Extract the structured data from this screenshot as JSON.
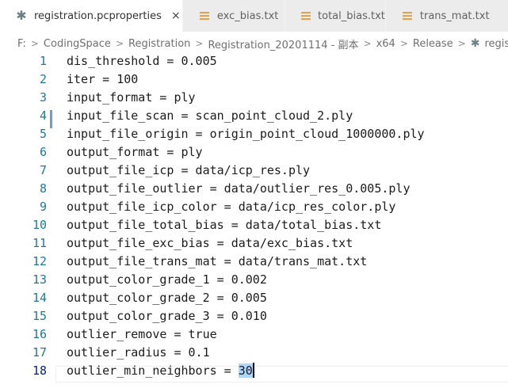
{
  "tabs": [
    {
      "label": "registration.pcproperties",
      "icon": "gear-icon",
      "active": true,
      "close": "×"
    },
    {
      "label": "exc_bias.txt",
      "icon": "text-file-icon",
      "active": false
    },
    {
      "label": "total_bias.txt",
      "icon": "text-file-icon",
      "active": false
    },
    {
      "label": "trans_mat.txt",
      "icon": "text-file-icon",
      "active": false
    }
  ],
  "breadcrumb": [
    "F:",
    "CodingSpace",
    "Registration",
    "Registration_20201114 - 副本",
    "x64",
    "Release",
    "registration.pcproperties"
  ],
  "breadcrumb_separator": ">",
  "editor": {
    "current_line": 18,
    "modified_line": 4,
    "lines": [
      {
        "num": "1",
        "text": "dis_threshold = 0.005"
      },
      {
        "num": "2",
        "text": "iter = 100"
      },
      {
        "num": "3",
        "text": "input_format = ply"
      },
      {
        "num": "4",
        "text": "input_file_scan = scan_point_cloud_2.ply"
      },
      {
        "num": "5",
        "text": "input_file_origin = origin_point_cloud_1000000.ply"
      },
      {
        "num": "6",
        "text": "output_format = ply"
      },
      {
        "num": "7",
        "text": "output_file_icp = data/icp_res.ply"
      },
      {
        "num": "8",
        "text": "output_file_outlier = data/outlier_res_0.005.ply"
      },
      {
        "num": "9",
        "text": "output_file_icp_color = data/icp_res_color.ply"
      },
      {
        "num": "10",
        "text": "output_file_total_bias = data/total_bias.txt"
      },
      {
        "num": "11",
        "text": "output_file_exc_bias = data/exc_bias.txt"
      },
      {
        "num": "12",
        "text": "output_file_trans_mat = data/trans_mat.txt"
      },
      {
        "num": "13",
        "text": "output_color_grade_1 = 0.002"
      },
      {
        "num": "14",
        "text": "output_color_grade_2 = 0.005"
      },
      {
        "num": "15",
        "text": "output_color_grade_3 = 0.010"
      },
      {
        "num": "16",
        "text": "outlier_remove = true"
      },
      {
        "num": "17",
        "text": "outlier_radius = 0.1"
      },
      {
        "num": "18",
        "text": "outlier_min_neighbors = ",
        "selected": "30"
      }
    ]
  },
  "colors": {
    "line_number": "#237893",
    "selection": "#add6ff",
    "modified_bar": "#6a9fc7",
    "text_file_icon": "#e2a14a"
  }
}
